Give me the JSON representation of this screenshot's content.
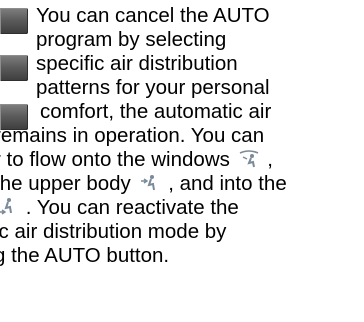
{
  "icons": {
    "button_1": "air-distribution-button-icon",
    "button_2": "air-distribution-button-icon",
    "button_3": "air-distribution-button-icon",
    "windows_symbol": "windshield-airflow-icon",
    "upper_body_symbol": "upper-body-airflow-icon",
    "footwell_symbol": "footwell-airflow-icon"
  },
  "colors": {
    "text": "#000000",
    "button": "#5a5a5a",
    "symbol": "#7a8a9a"
  },
  "text": {
    "line1": "You can cancel the AUTO",
    "line2": "program by selecting",
    "line3": "specific air distribution",
    "line4": "patterns for your personal",
    "line5": "comfort, the automatic air",
    "line6": "remains in operation. You can",
    "line7a": "r to flow onto the windows",
    "line8a": "the upper body",
    "line8b": ", and into the",
    "line9a": ". You can reactivate the",
    "line10": "ic air distribution mode by",
    "line11": "g the AUTO button."
  }
}
